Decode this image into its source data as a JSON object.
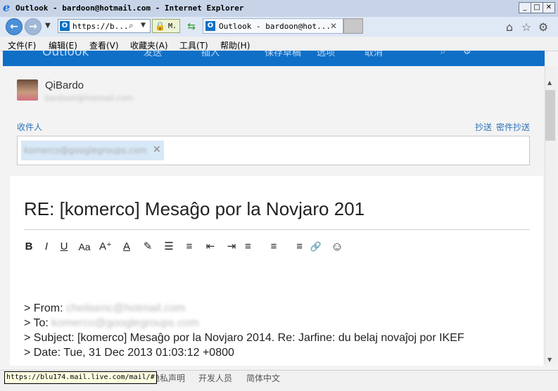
{
  "window": {
    "title": "Outlook - bardoon@hotmail.com - Internet Explorer",
    "controls": [
      "_",
      "□",
      "✕"
    ]
  },
  "nav": {
    "address_text": "https://b...",
    "lock_text": "M.",
    "tab_title": "Outlook - bardoon@hot...",
    "tab_close": "✕"
  },
  "menu": [
    "文件(F)",
    "编辑(E)",
    "查看(V)",
    "收藏夹(A)",
    "工具(T)",
    "帮助(H)"
  ],
  "outlook_header": {
    "brand": "Outlook",
    "items": [
      "发送",
      "插入",
      "保存草稿",
      "选项",
      "取消"
    ]
  },
  "message": {
    "from_name": "QiBardo",
    "from_email": "bardoon@hotmail.com",
    "to_label": "收件人",
    "cc_label": "抄送",
    "bcc_label": "密件抄送",
    "recipient": "komerco@googlegroups.com",
    "subject": "RE: [komerco] Mesaĝo por la Novjaro 201",
    "toolbar": [
      "B",
      "I",
      "U",
      "Aa",
      "A⁺",
      "A",
      "✎",
      "☰",
      "≡",
      "⇤",
      "⇥",
      "≡",
      "≡",
      "≡",
      "🔗",
      "☺"
    ],
    "quote": {
      "from_prefix": "> From: ",
      "from_value": "chelisenc@hotmail.com",
      "to_prefix": "> To: ",
      "to_value": "komerco@googlegroups.com",
      "subject_line": "> Subject: [komerco] Mesaĝo por la Novjaro 2014. Re: Jarfine: du belaj novaĵoj por IKEF",
      "date_line": "> Date: Tue, 31 Dec 2013 01:03:12 +0800"
    }
  },
  "status": {
    "url": "https://blu174.mail.live.com/mail/#",
    "footer_links": [
      "隐私声明",
      "开发人员",
      "简体中文"
    ]
  }
}
